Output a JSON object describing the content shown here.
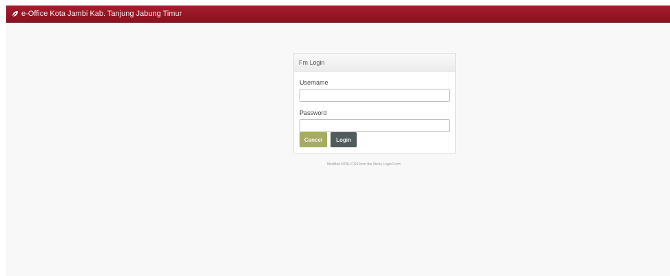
{
  "app": {
    "title": "e-Office Kota Jambi Kab. Tanjung Jabung Timur",
    "brand_color": "#9b1a2a"
  },
  "login_panel": {
    "heading": "Fm Login",
    "username_label": "Username",
    "username_value": "",
    "password_label": "Password",
    "password_value": "",
    "cancel_label": "Cancel",
    "login_label": "Login"
  },
  "footer": {
    "note": "Modified NTBU CSS from the Sticky Login Form"
  },
  "icons": {
    "brand": "leaf-icon"
  },
  "colors": {
    "cancel_button": "#a6ab62",
    "login_button": "#515a5c"
  }
}
